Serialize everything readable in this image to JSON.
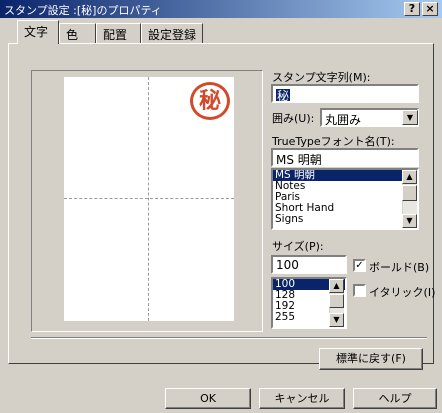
{
  "window": {
    "title": "スタンプ設定 :[秘]のプロパティ",
    "help_button": "?",
    "close_button": "×"
  },
  "tabs": [
    {
      "label": "文字",
      "active": true
    },
    {
      "label": "色",
      "active": false
    },
    {
      "label": "配置",
      "active": false
    },
    {
      "label": "設定登録",
      "active": false
    }
  ],
  "preview": {
    "stamp_char": "秘",
    "stamp_color": "#d2492b"
  },
  "stamp_text": {
    "label": "スタンプ文字列(M):",
    "value": "秘"
  },
  "enclosure": {
    "label": "囲み(U):",
    "value": "丸囲み"
  },
  "font": {
    "label": "TrueTypeフォント名(T):",
    "value": "MS 明朝",
    "options": [
      "MS 明朝",
      "Notes",
      "Paris",
      "Short Hand",
      "Signs"
    ],
    "selected_index": 0
  },
  "size": {
    "label": "サイズ(P):",
    "value": "100",
    "options": [
      "100",
      "128",
      "192",
      "255"
    ],
    "selected_index": 0
  },
  "bold": {
    "label": "ボールド(B)",
    "checked": true,
    "mark": "✓"
  },
  "italic": {
    "label": "イタリック(I)",
    "checked": false
  },
  "buttons": {
    "reset": "標準に戻す(F)",
    "ok": "OK",
    "cancel": "キャンセル",
    "help": "ヘルプ"
  }
}
